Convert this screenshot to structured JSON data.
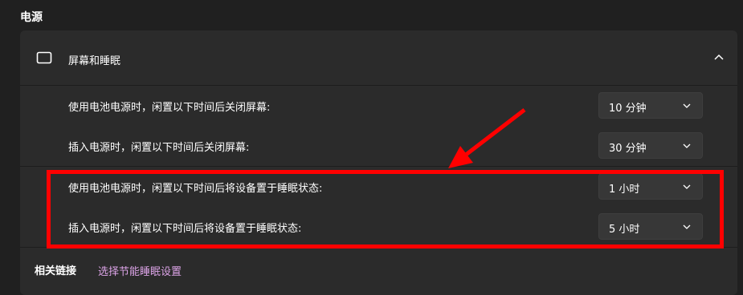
{
  "section_title": "电源",
  "card": {
    "title": "屏幕和睡眠",
    "icon": "screen-sleep-icon",
    "expand_icon": "chevron-up-icon"
  },
  "settings": [
    {
      "label": "使用电池电源时，闲置以下时间后关闭屏幕:",
      "value": "10 分钟"
    },
    {
      "label": "插入电源时，闲置以下时间后关闭屏幕:",
      "value": "30 分钟"
    },
    {
      "label": "使用电池电源时，闲置以下时间后将设备置于睡眠状态:",
      "value": "1 小时"
    },
    {
      "label": "插入电源时，闲置以下时间后将设备置于睡眠状态:",
      "value": "5 小时"
    }
  ],
  "related": {
    "heading": "相关链接",
    "link": "选择节能睡眠设置"
  },
  "colors": {
    "background": "#202020",
    "card": "#2b2b2b",
    "dropdown": "#373737",
    "link": "#dba3e6",
    "annotation": "#ff0000"
  }
}
